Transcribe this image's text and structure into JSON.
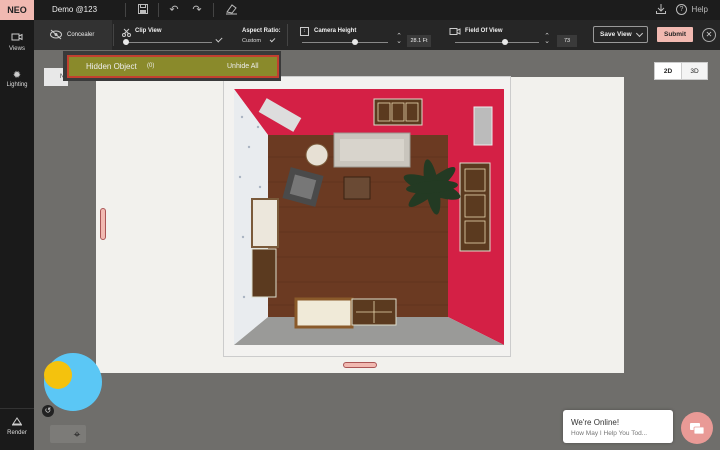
{
  "app": {
    "logo": "NEO",
    "project_name": "Demo @123",
    "help_label": "Help"
  },
  "topbar": {
    "icons": [
      "save-icon",
      "undo-icon",
      "redo-icon",
      "eraser-icon",
      "download-icon",
      "help-icon"
    ]
  },
  "sidebar": {
    "items": [
      {
        "label": "Views",
        "icon": "video-camera-icon"
      },
      {
        "label": "Lighting",
        "icon": "sun-icon"
      },
      {
        "label": "Render",
        "icon": "render-icon"
      }
    ]
  },
  "toolbar": {
    "concealer_label": "Concealer",
    "clip_view_label": "Clip View",
    "clip_view_level": 0,
    "aspect_ratio_label": "Aspect Ratio:",
    "aspect_ratio_value": "Custom",
    "camera_height_label": "Camera Height",
    "camera_height_value": "28.1 Ft",
    "camera_height_level": 0.62,
    "field_of_view_label": "Field Of View",
    "field_of_view_value": "73",
    "field_of_view_level": 0.6,
    "save_view_label": "Save View",
    "submit_label": "Submit"
  },
  "concealer_dropdown": {
    "hidden_object_label": "Hidden Object",
    "hidden_object_count": "(0)",
    "unhide_all_label": "Unhide All",
    "tab_partial_label": "Nu"
  },
  "view_toggle": {
    "options": [
      "2D",
      "3D"
    ]
  },
  "chat": {
    "title": "We're Online!",
    "subtitle": "How May I Help You Tod..."
  },
  "colors": {
    "accent": "#f1b9b1",
    "wall_red": "#d42045",
    "floor_wood": "#6b3a22",
    "highlight_border": "#c2402f",
    "dropdown_row": "#8a8a2b",
    "blue_circle": "#5bc7f5",
    "yellow_circle": "#f4c20d"
  }
}
